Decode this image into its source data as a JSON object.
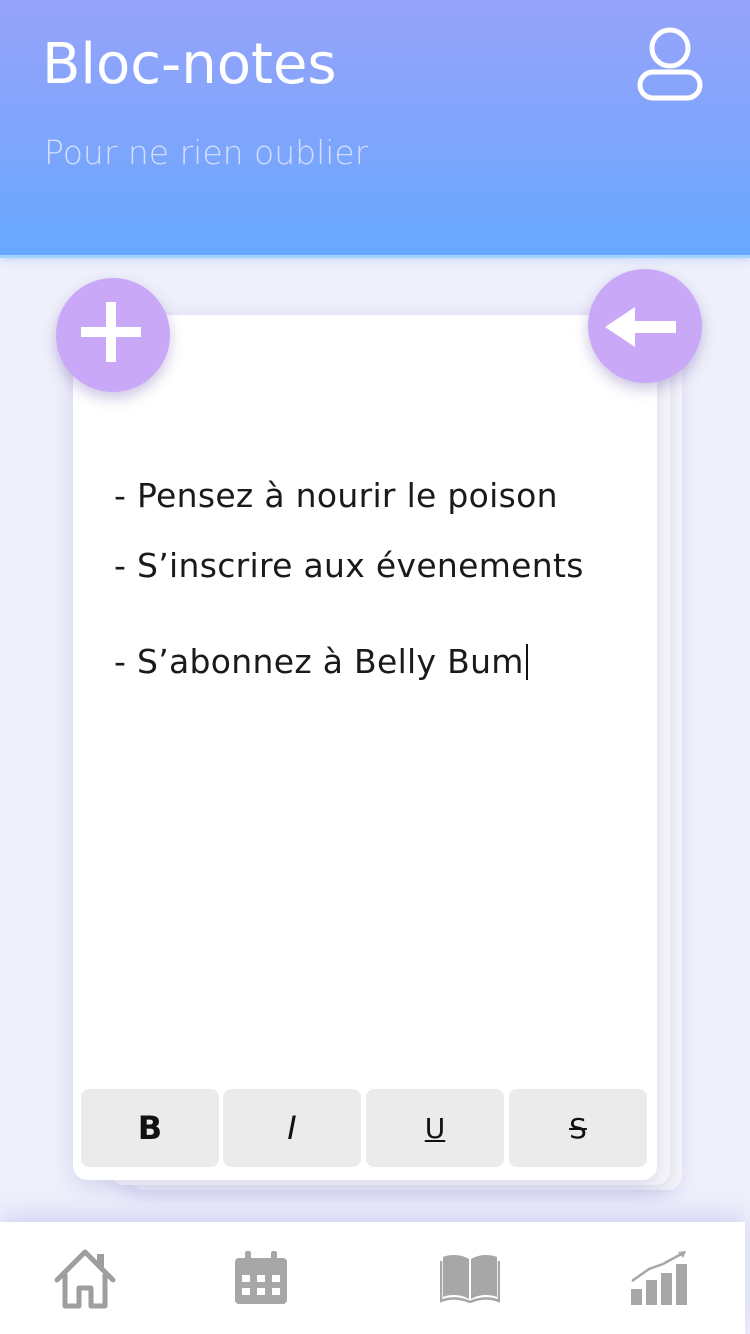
{
  "header": {
    "title": "Bloc-notes",
    "subtitle": "Pour ne rien oublier",
    "profile_icon": "user-icon"
  },
  "actions": {
    "add_icon": "plus-icon",
    "back_icon": "arrow-left-icon"
  },
  "note": {
    "lines": [
      "- Pensez à nourir le poison",
      "- S’inscrire aux évenements",
      "- S’abonnez à Belly Bum"
    ]
  },
  "toolbar": {
    "bold_label": "B",
    "italic_label": "I",
    "underline_label": "U",
    "strike_label": "S"
  },
  "nav": {
    "items": [
      {
        "icon": "home-icon"
      },
      {
        "icon": "calendar-icon"
      },
      {
        "icon": "book-icon"
      },
      {
        "icon": "stats-icon"
      }
    ]
  },
  "colors": {
    "header_top": "#97a3fa",
    "header_bottom": "#66a8fe",
    "fab": "#c9a9f7",
    "background": "#eff0fb",
    "nav_icon": "#9e9e9e"
  }
}
